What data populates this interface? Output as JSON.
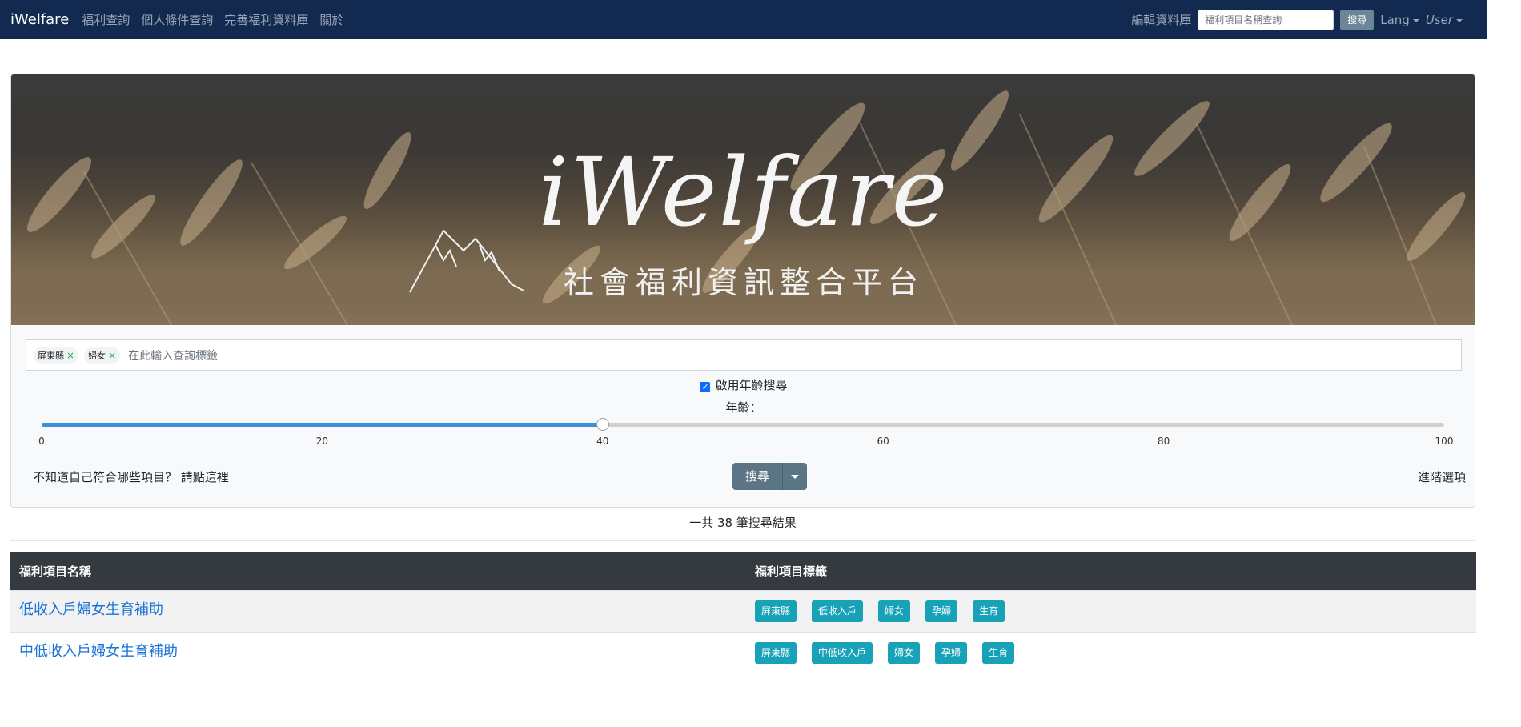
{
  "navbar": {
    "brand": "iWelfare",
    "links": [
      "福利查詢",
      "個人條件查詢",
      "完善福利資料庫",
      "關於"
    ],
    "edit_db": "編輯資料庫",
    "search_placeholder": "福利項目名稱查詢",
    "search_button": "搜尋",
    "lang": "Lang",
    "user": "User",
    "bg_color": "#132a50"
  },
  "banner": {
    "title": "iWelfare",
    "subtitle": "社會福利資訊整合平台"
  },
  "search": {
    "chips": [
      "屏東縣",
      "婦女"
    ],
    "placeholder": "在此輸入查詢標籤",
    "age_toggle_label": "啟用年齡搜尋",
    "age_toggle_checked": true,
    "age_label": "年齡：",
    "age_value": 40,
    "age_min": 0,
    "age_max": 100,
    "ticks": [
      "0",
      "20",
      "40",
      "60",
      "80",
      "100"
    ],
    "hint": "不知道自己符合哪些項目？ 請點這裡",
    "search_button": "搜尋",
    "advanced": "進階選項"
  },
  "results": {
    "count_text": "一共 38 筆搜尋結果",
    "columns": [
      "福利項目名稱",
      "福利項目標籤"
    ],
    "rows": [
      {
        "name": "低收入戶婦女生育補助",
        "tags": [
          "屏東縣",
          "低收入戶",
          "婦女",
          "孕婦",
          "生育"
        ]
      },
      {
        "name": "中低收入戶婦女生育補助",
        "tags": [
          "屏東縣",
          "中低收入戶",
          "婦女",
          "孕婦",
          "生育"
        ]
      }
    ]
  }
}
